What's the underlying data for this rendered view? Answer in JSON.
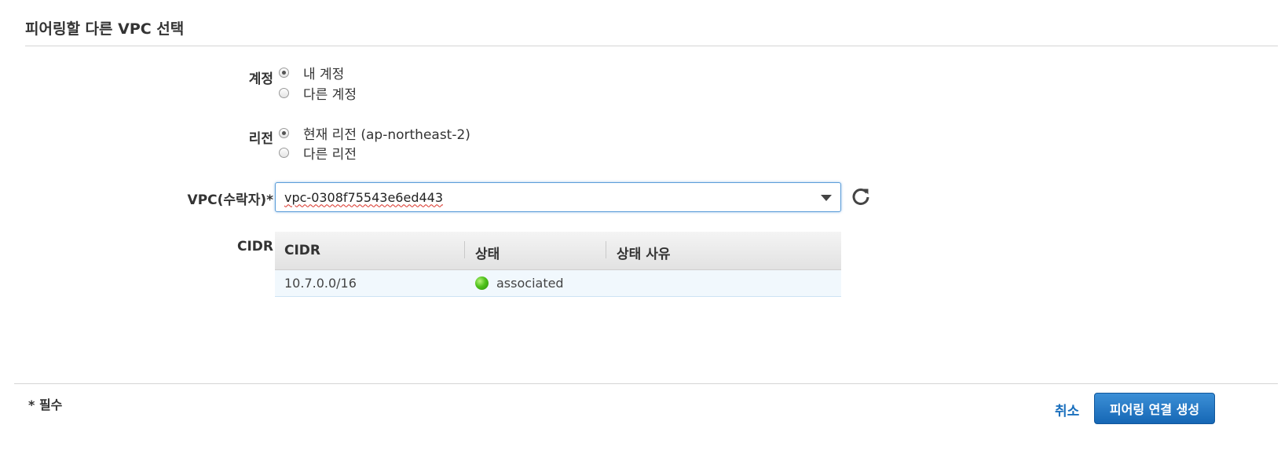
{
  "section": {
    "title": "피어링할 다른 VPC 선택"
  },
  "account": {
    "label": "계정",
    "options": [
      {
        "label": "내 계정",
        "checked": true
      },
      {
        "label": "다른 계정",
        "checked": false
      }
    ]
  },
  "region": {
    "label": "리전",
    "options": [
      {
        "label": "현재 리전 (ap-northeast-2)",
        "checked": true
      },
      {
        "label": "다른 리전",
        "checked": false
      }
    ]
  },
  "vpc": {
    "label": "VPC(수락자)*",
    "selected_value": "vpc-0308f75543e6ed443",
    "refresh_icon": "refresh-icon"
  },
  "cidr": {
    "label": "CIDR",
    "columns": [
      "CIDR",
      "상태",
      "상태 사유"
    ],
    "rows": [
      {
        "cidr": "10.7.0.0/16",
        "status": "associated",
        "status_color": "#4fc21b",
        "reason": ""
      }
    ]
  },
  "footer": {
    "required_note": "* 필수",
    "cancel_label": "취소",
    "create_label": "피어링 연결 생성",
    "primary_color": "#1a6fbd"
  }
}
